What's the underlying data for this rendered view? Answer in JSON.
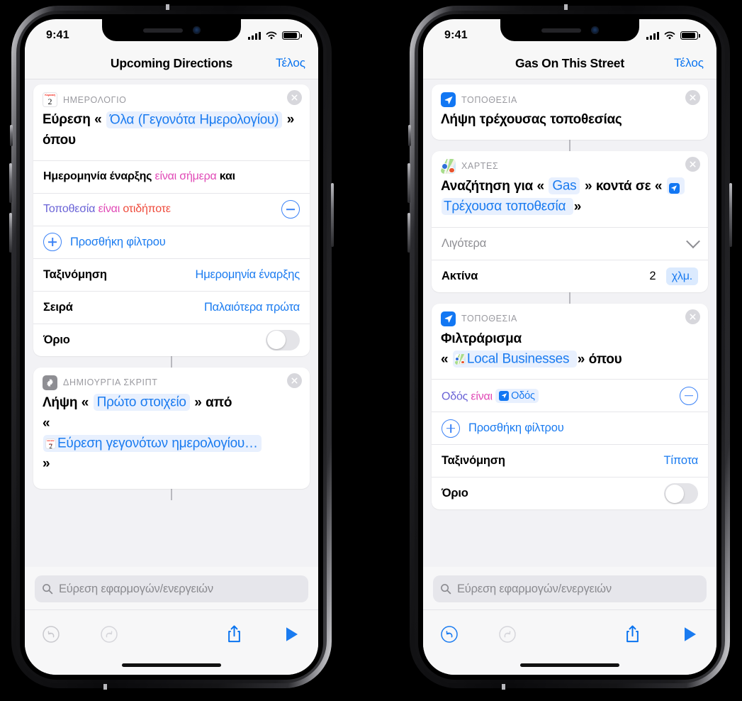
{
  "phones": [
    {
      "id": "left",
      "status": {
        "time": "9:41",
        "signal_icon": "cellular-bars-icon",
        "wifi_icon": "wifi-icon",
        "battery_icon": "battery-icon"
      },
      "navbar": {
        "title": "Upcoming Directions",
        "done_label": "Τέλος"
      },
      "cards": [
        {
          "header": {
            "icon": "calendar-icon",
            "icon_month": "Κυριακή",
            "icon_day": "2",
            "label": "ΗΜΕΡΟΛΟΓΙΟ",
            "close_icon": "close-circle-icon"
          },
          "action": {
            "prefix": "Εύρεση",
            "open_guillemet": "«",
            "token": "Όλα (Γεγονότα Ημερολογίου)",
            "close_guillemet": "»",
            "suffix": "όπου"
          },
          "rows": [
            {
              "type": "filter_text",
              "parts": [
                {
                  "text": "Ημερομηνία έναρξης",
                  "color": "#000000",
                  "style": "bold"
                },
                {
                  "text": "είναι σήμερα",
                  "color": "#e049b6",
                  "style": "normal"
                },
                {
                  "text": "και",
                  "color": "#000000",
                  "style": "bold"
                }
              ]
            },
            {
              "type": "filter_row",
              "attr": "Τοποθεσία",
              "op": "είναι",
              "value": "οτιδήποτε",
              "control": "minus-button"
            },
            {
              "type": "add_filter",
              "label": "Προσθήκη φίλτρου",
              "control": "plus-button"
            },
            {
              "type": "value_row",
              "label": "Ταξινόμηση",
              "value": "Ημερομηνία έναρξης"
            },
            {
              "type": "value_row",
              "label": "Σειρά",
              "value": "Παλαιότερα πρώτα"
            },
            {
              "type": "toggle_row",
              "label": "Όριο",
              "on": false
            }
          ]
        },
        {
          "header": {
            "icon": "gear-icon",
            "label": "ΔΗΜΙΟΥΡΓΙΑ ΣΚΡΙΠΤ",
            "close_icon": "close-circle-icon"
          },
          "action": {
            "prefix": "Λήψη",
            "open_guillemet": "«",
            "token": "Πρώτο στοιχείο",
            "close_guillemet": "»",
            "suffix": "από",
            "second_open": "«",
            "second_token": "Εύρεση γεγονότων ημερολογίου…",
            "second_token_icon": "calendar-icon",
            "second_close": "»"
          },
          "rows": []
        }
      ],
      "search": {
        "placeholder": "Εύρεση εφαρμογών/ενεργειών",
        "icon": "search-icon"
      },
      "toolbar": {
        "undo": {
          "icon": "undo-icon",
          "enabled": false,
          "color": "#c7c7cc"
        },
        "redo": {
          "icon": "redo-icon",
          "enabled": false,
          "color": "#c7c7cc"
        },
        "share": {
          "icon": "share-icon",
          "color": "#0a74f0"
        },
        "play": {
          "icon": "play-icon",
          "color": "#1a7bf0"
        }
      }
    },
    {
      "id": "right",
      "status": {
        "time": "9:41",
        "signal_icon": "cellular-bars-icon",
        "wifi_icon": "wifi-icon",
        "battery_icon": "battery-icon"
      },
      "navbar": {
        "title": "Gas On This Street",
        "done_label": "Τέλος"
      },
      "cards": [
        {
          "header": {
            "icon": "location-icon",
            "label": "ΤΟΠΟΘΕΣΙΑ",
            "close_icon": "close-circle-icon"
          },
          "action": {
            "plain": "Λήψη τρέχουσας τοποθεσίας"
          },
          "rows": []
        },
        {
          "header": {
            "icon": "maps-icon",
            "label": "ΧΑΡΤΕΣ",
            "close_icon": "close-circle-icon"
          },
          "action": {
            "prefix": "Αναζήτηση για",
            "open_guillemet": "«",
            "token": "Gas",
            "close_guillemet": "»",
            "suffix": "κοντά σε",
            "second_open": "«",
            "second_token": "Τρέχουσα τοποθεσία",
            "second_token_icon": "location-icon",
            "second_close": "»"
          },
          "rows": [
            {
              "type": "collapse_row",
              "label": "Λιγότερα",
              "control": "chevron-down-icon"
            },
            {
              "type": "unit_row",
              "label": "Ακτίνα",
              "value": "2",
              "unit": "χλμ."
            }
          ]
        },
        {
          "header": {
            "icon": "location-icon",
            "label": "ΤΟΠΟΘΕΣΙΑ",
            "close_icon": "close-circle-icon"
          },
          "action": {
            "prefix": "Φιλτράρισμα",
            "second_open": "«",
            "second_token": "Local Businesses",
            "second_token_icon": "maps-icon",
            "second_close": "»",
            "suffix2": "όπου"
          },
          "rows": [
            {
              "type": "filter_row_pill",
              "attr": "Οδός",
              "op": "είναι",
              "pill_value": "Οδός",
              "pill_icon": "location-icon",
              "control": "minus-button"
            },
            {
              "type": "add_filter",
              "label": "Προσθήκη φίλτρου",
              "control": "plus-button"
            },
            {
              "type": "value_row",
              "label": "Ταξινόμηση",
              "value": "Τίποτα"
            },
            {
              "type": "toggle_row",
              "label": "Όριο",
              "on": false
            }
          ]
        }
      ],
      "search": {
        "placeholder": "Εύρεση εφαρμογών/ενεργειών",
        "icon": "search-icon"
      },
      "toolbar": {
        "undo": {
          "icon": "undo-icon",
          "enabled": true,
          "color": "#1a7bf0"
        },
        "redo": {
          "icon": "redo-icon",
          "enabled": false,
          "color": "#c7c7cc"
        },
        "share": {
          "icon": "share-icon",
          "color": "#0a74f0"
        },
        "play": {
          "icon": "play-icon",
          "color": "#1a7bf0"
        }
      }
    }
  ],
  "colors": {
    "accent_blue": "#1a7bf0",
    "token_bg": "#e8f0fe",
    "magenta": "#e049b6",
    "purple": "#6a63d6",
    "red": "#ef4b3c",
    "gray_label": "#9a9aa0"
  }
}
